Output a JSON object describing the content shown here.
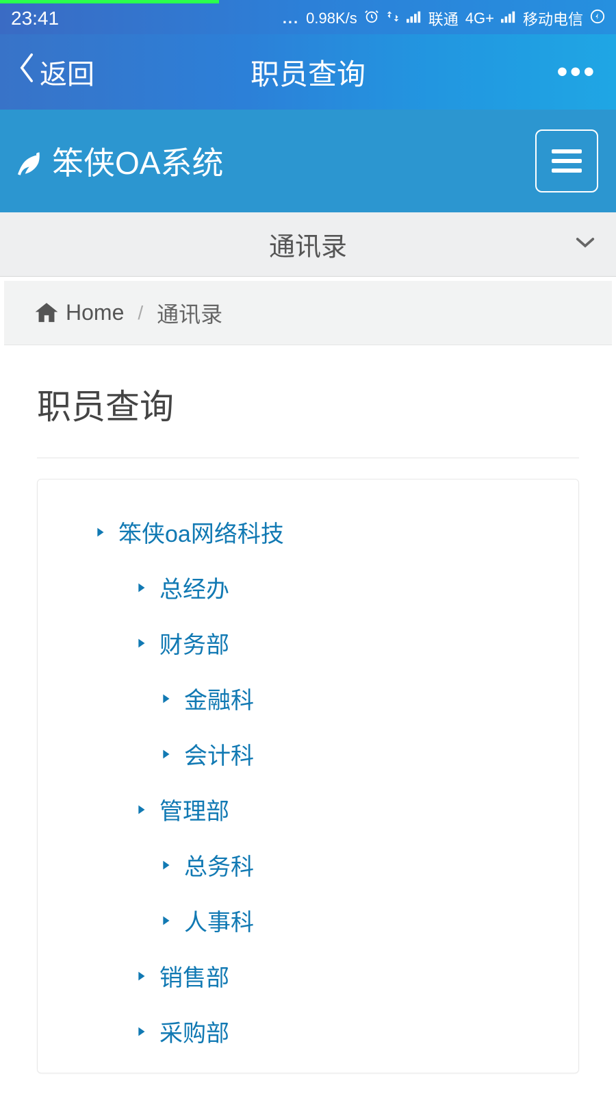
{
  "status_bar": {
    "time": "23:41",
    "dots": "...",
    "speed": "0.98K/s",
    "carrier1": "联通",
    "net1": "4G+",
    "carrier2": "移动电信"
  },
  "app_header": {
    "back": "返回",
    "title": "职员查询"
  },
  "brand": {
    "name": "笨侠OA系统"
  },
  "section_dropdown": {
    "label": "通讯录"
  },
  "breadcrumb": {
    "home": "Home",
    "current": "通讯录"
  },
  "page": {
    "heading": "职员查询"
  },
  "tree": {
    "n0": "笨侠oa网络科技",
    "n1": "总经办",
    "n2": "财务部",
    "n3": "金融科",
    "n4": "会计科",
    "n5": "管理部",
    "n6": "总务科",
    "n7": "人事科",
    "n8": "销售部",
    "n9": "采购部"
  }
}
